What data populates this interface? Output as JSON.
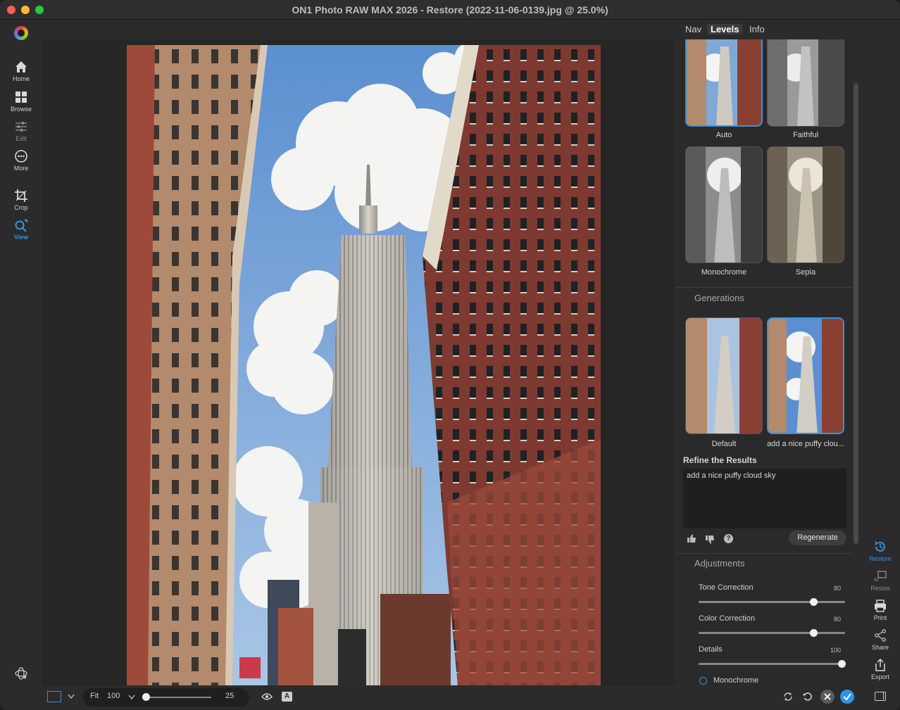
{
  "window": {
    "title": "ON1 Photo RAW MAX 2026 - Restore (2022-11-06-0139.jpg @ 25.0%)"
  },
  "left_toolbar": {
    "items": [
      {
        "label": "Home",
        "icon": "home-icon"
      },
      {
        "label": "Browse",
        "icon": "grid-icon"
      },
      {
        "label": "Edit",
        "icon": "sliders-icon"
      },
      {
        "label": "More",
        "icon": "more-icon"
      },
      {
        "label": "Crop",
        "icon": "crop-icon"
      },
      {
        "label": "View",
        "icon": "view-icon"
      }
    ]
  },
  "panel_tabs": {
    "nav": "Nav",
    "levels": "Levels",
    "info": "Info"
  },
  "styles": {
    "items": [
      {
        "label": "Auto"
      },
      {
        "label": "Faithful"
      },
      {
        "label": "Monochrome"
      },
      {
        "label": "Sepia"
      }
    ]
  },
  "generations": {
    "heading": "Generations",
    "items": [
      {
        "label": "Default"
      },
      {
        "label": "add a nice puffy clou..."
      }
    ]
  },
  "refine": {
    "heading": "Refine the Results",
    "prompt": "add a nice puffy cloud sky",
    "regenerate": "Regenerate"
  },
  "adjustments": {
    "heading": "Adjustments",
    "sliders": [
      {
        "label": "Tone Correction",
        "value": 80
      },
      {
        "label": "Color Correction",
        "value": 80
      },
      {
        "label": "Details",
        "value": 100
      }
    ],
    "monochrome": "Monochrome"
  },
  "right_toolbar": {
    "items": [
      {
        "label": "Restore",
        "icon": "restore-icon"
      },
      {
        "label": "Resize",
        "icon": "resize-icon"
      },
      {
        "label": "Print",
        "icon": "print-icon"
      },
      {
        "label": "Share",
        "icon": "share-icon"
      },
      {
        "label": "Export",
        "icon": "export-icon"
      }
    ]
  },
  "bottom_bar": {
    "fit": "Fit",
    "zoom": "100",
    "zoom_slider_value": "25",
    "zoom_slider_fraction": 0.0
  },
  "colors": {
    "accent": "#2f95e5",
    "panel": "#2a2a2a",
    "background": "#2b2b2b"
  }
}
